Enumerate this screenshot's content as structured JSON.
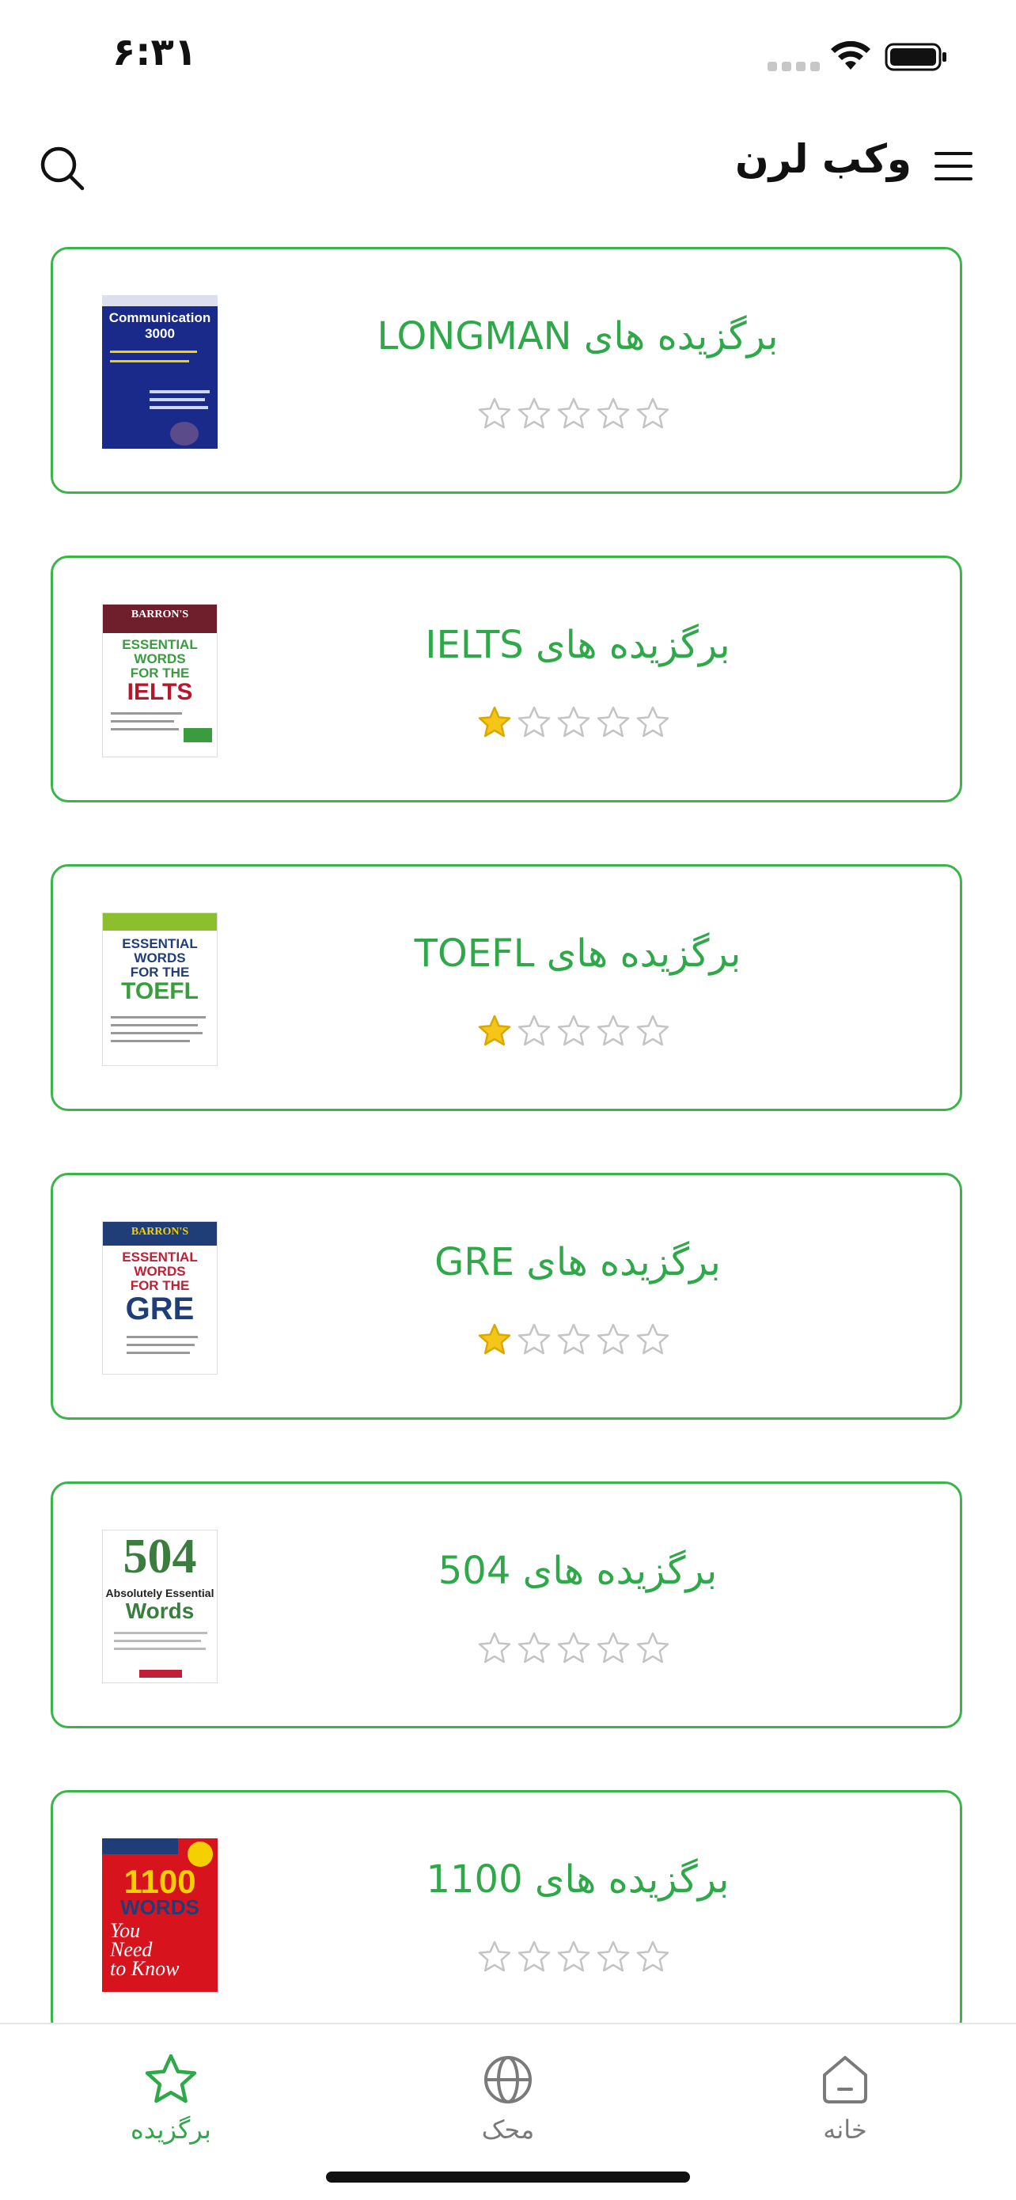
{
  "status_bar": {
    "time": "۶:۳۱"
  },
  "header": {
    "title": "وکب لرن"
  },
  "cards": [
    {
      "title": "برگزیده های LONGMAN",
      "rating": 0,
      "cover": "LONGMAN Communication 3000"
    },
    {
      "title": "برگزیده های IELTS",
      "rating": 1,
      "cover": "BARRON'S ESSENTIAL WORDS FOR THE IELTS"
    },
    {
      "title": "برگزیده های TOEFL",
      "rating": 1,
      "cover": "BARRON'S ESSENTIAL WORDS FOR THE TOEFL"
    },
    {
      "title": "برگزیده های GRE",
      "rating": 1,
      "cover": "BARRON'S ESSENTIAL WORDS FOR THE GRE"
    },
    {
      "title": "برگزیده های 504",
      "rating": 0,
      "cover": "504 Absolutely Essential Words"
    },
    {
      "title": "برگزیده های 1100",
      "rating": 0,
      "cover": "BARRON'S 1100 WORDS You Need to Know"
    }
  ],
  "rating_max": 5,
  "bottom_nav": {
    "favorites": "برگزیده",
    "explore": "محک",
    "home": "خانه"
  },
  "colors": {
    "accent": "#2fa84a",
    "border": "#3bb44a",
    "star_filled": "#f5c518",
    "star_empty": "#c4c4c4"
  }
}
